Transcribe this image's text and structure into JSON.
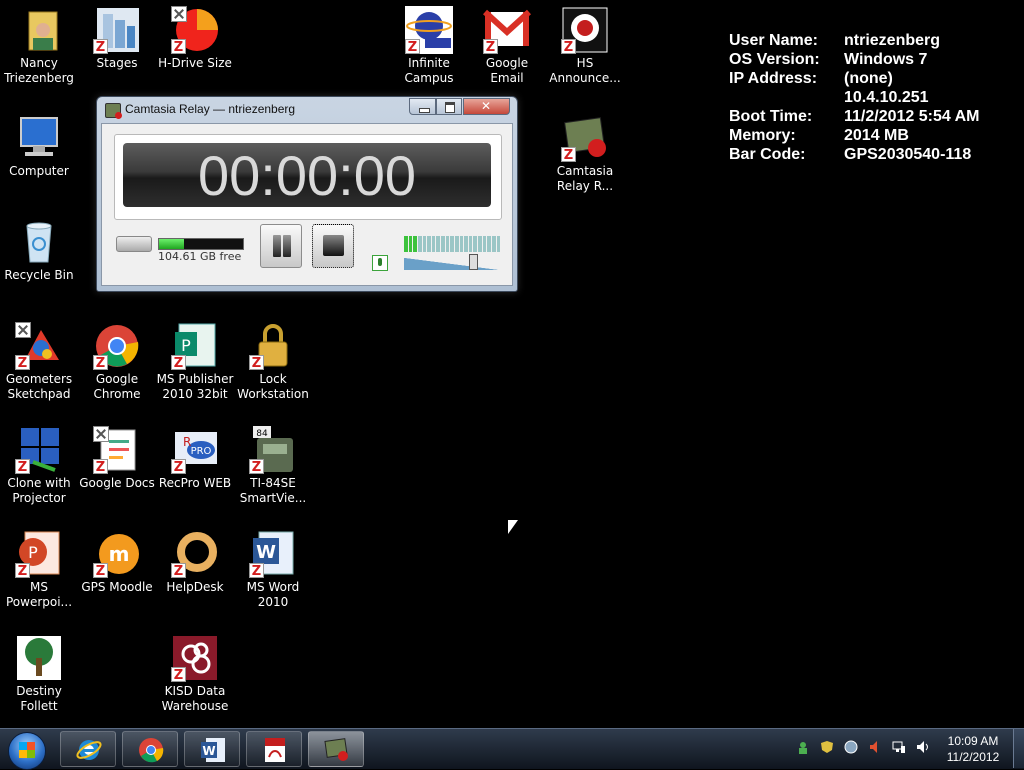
{
  "desktop": {
    "icons": [
      {
        "label": "Nancy Triezenberg",
        "icon": "user-folder-icon"
      },
      {
        "label": "Stages",
        "icon": "stages-icon"
      },
      {
        "label": "H-Drive Size",
        "icon": "pie-chart-icon"
      },
      {
        "label": "Infinite Campus",
        "icon": "infinite-campus-icon"
      },
      {
        "label": "Google Email",
        "icon": "gmail-icon"
      },
      {
        "label": "HS Announce...",
        "icon": "hs-announcements-icon"
      },
      {
        "label": "Computer",
        "icon": "computer-icon"
      },
      {
        "label": "Camtasia Relay R...",
        "icon": "camtasia-relay-icon"
      },
      {
        "label": "Recycle Bin",
        "icon": "recycle-bin-icon"
      },
      {
        "label": "Geometers Sketchpad",
        "icon": "sketchpad-icon"
      },
      {
        "label": "Google Chrome",
        "icon": "chrome-icon"
      },
      {
        "label": "MS Publisher 2010 32bit",
        "icon": "publisher-icon"
      },
      {
        "label": "Lock Workstation",
        "icon": "lock-icon"
      },
      {
        "label": "Clone with Projector",
        "icon": "projector-icon"
      },
      {
        "label": "Google Docs",
        "icon": "google-docs-icon"
      },
      {
        "label": "RecPro WEB",
        "icon": "recpro-icon"
      },
      {
        "label": "TI-84SE SmartVie...",
        "icon": "calculator-icon"
      },
      {
        "label": "MS Powerpoi...",
        "icon": "powerpoint-icon"
      },
      {
        "label": "GPS Moodle",
        "icon": "moodle-icon"
      },
      {
        "label": "HelpDesk",
        "icon": "lifebuoy-icon"
      },
      {
        "label": "MS Word 2010",
        "icon": "word-icon"
      },
      {
        "label": "Destiny Follett",
        "icon": "tree-icon"
      },
      {
        "label": "KISD Data Warehouse",
        "icon": "kisd-icon"
      }
    ]
  },
  "sysinfo": {
    "rows": [
      {
        "key": "User Name:",
        "value": "ntriezenberg"
      },
      {
        "key": "OS Version:",
        "value": "Windows 7"
      },
      {
        "key": "IP Address:",
        "value": "(none)"
      },
      {
        "key": "",
        "value": "10.4.10.251"
      },
      {
        "key": "Boot Time:",
        "value": "11/2/2012 5:54 AM"
      },
      {
        "key": "Memory:",
        "value": "2014 MB"
      },
      {
        "key": "Bar Code:",
        "value": "GPS2030540-118"
      }
    ]
  },
  "relay": {
    "title": "Camtasia Relay — ntriezenberg",
    "timer": "00:00:00",
    "free_space": "104.61 GB free",
    "disk_meter_fraction": 0.3,
    "mic_level_fraction": 0.12,
    "volume_fraction": 0.75
  },
  "taskbar": {
    "apps": [
      {
        "name": "internet-explorer-icon"
      },
      {
        "name": "chrome-icon"
      },
      {
        "name": "word-icon"
      },
      {
        "name": "pdf-icon"
      },
      {
        "name": "camtasia-relay-icon"
      }
    ],
    "clock_time": "10:09 AM",
    "clock_date": "11/2/2012"
  },
  "colors": {
    "desktop": "#000000",
    "z_badge": "#d21e1e",
    "meter_green": "#1fa61f"
  }
}
